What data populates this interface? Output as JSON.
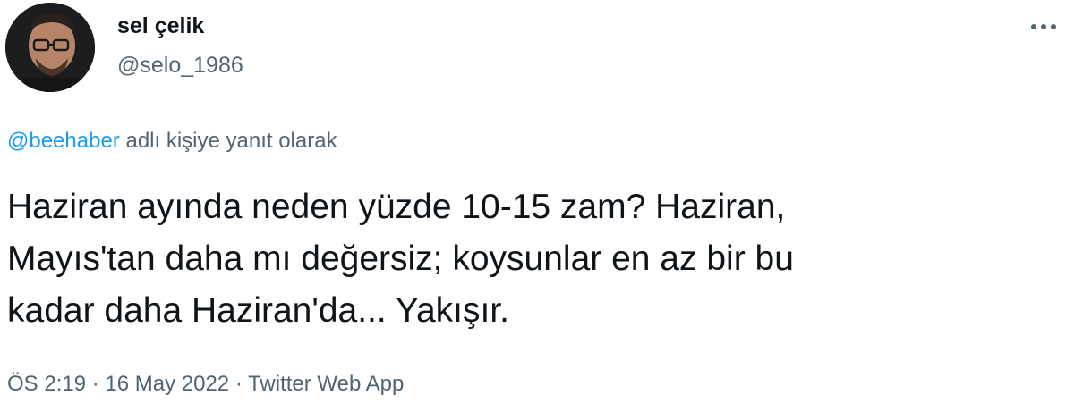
{
  "author": {
    "display_name": "sel çelik",
    "handle": "@selo_1986"
  },
  "more_icon": "more-horizontal-icon",
  "reply_context": {
    "mention": "@beehaber",
    "suffix": " adlı kişiye yanıt olarak"
  },
  "tweet": {
    "lines": [
      "Haziran ayında neden yüzde 10-15 zam? Haziran,",
      "Mayıs'tan daha mı değersiz; koysunlar en az bir bu",
      "kadar daha Haziran'da... Yakışır."
    ]
  },
  "meta": {
    "time": "ÖS 2:19",
    "separator": " · ",
    "date": "16 May 2022",
    "source": "Twitter Web App"
  },
  "colors": {
    "text_primary": "#0f1419",
    "text_secondary": "#536471",
    "link": "#1d9bf0"
  }
}
